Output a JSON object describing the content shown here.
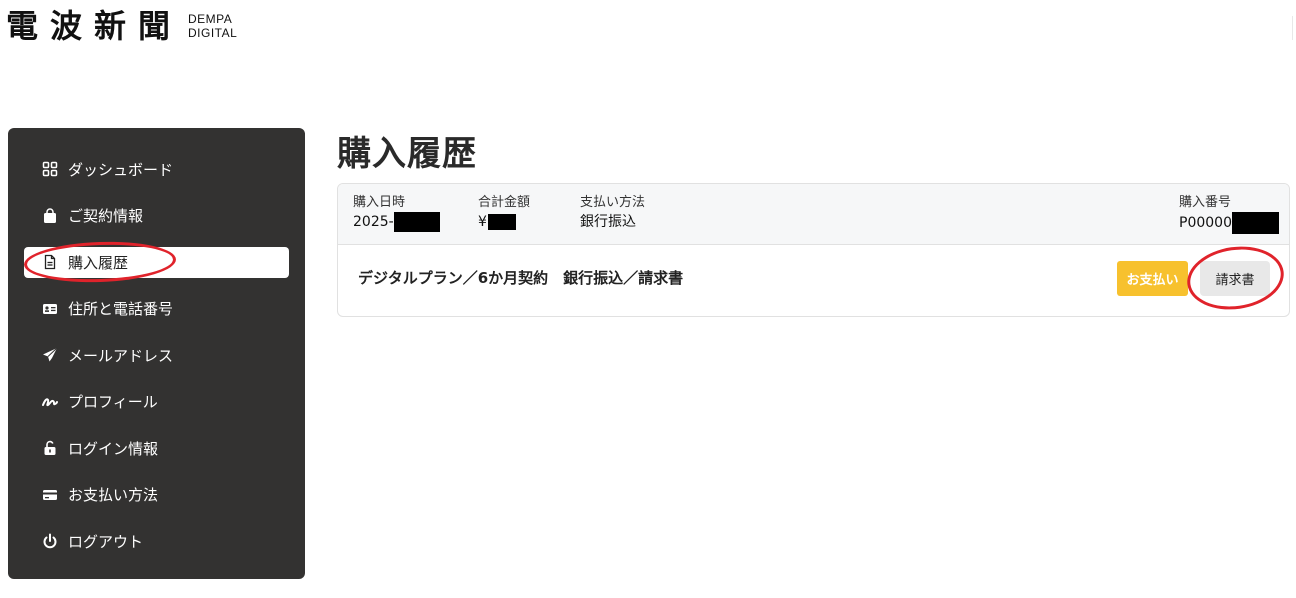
{
  "logo": {
    "kanji": "電波新聞",
    "en_line1": "DEMPA",
    "en_line2": "DIGITAL"
  },
  "sidebar": {
    "items": [
      {
        "label": "ダッシュボード",
        "icon": "dashboard-icon"
      },
      {
        "label": "ご契約情報",
        "icon": "shopping-bag-icon"
      },
      {
        "label": "購入履歴",
        "icon": "document-icon",
        "active": true
      },
      {
        "label": "住所と電話番号",
        "icon": "id-card-icon"
      },
      {
        "label": "メールアドレス",
        "icon": "paper-plane-icon"
      },
      {
        "label": "プロフィール",
        "icon": "signature-icon"
      },
      {
        "label": "ログイン情報",
        "icon": "unlock-icon"
      },
      {
        "label": "お支払い方法",
        "icon": "credit-card-icon"
      },
      {
        "label": "ログアウト",
        "icon": "power-icon"
      }
    ]
  },
  "main": {
    "title": "購入履歴",
    "order": {
      "date_label": "購入日時",
      "date_value": "2025-",
      "total_label": "合計金額",
      "total_value": "¥",
      "method_label": "支払い方法",
      "method_value": "銀行振込",
      "number_label": "購入番号",
      "number_value": "P00000",
      "item_text": "デジタルプラン／6か月契約　銀行振込／請求書",
      "pay_button": "お支払い",
      "invoice_button": "請求書"
    }
  },
  "colors": {
    "sidebar_bg": "#333231",
    "pay_button": "#f7c12e",
    "annotation_circle": "#e0232b"
  }
}
